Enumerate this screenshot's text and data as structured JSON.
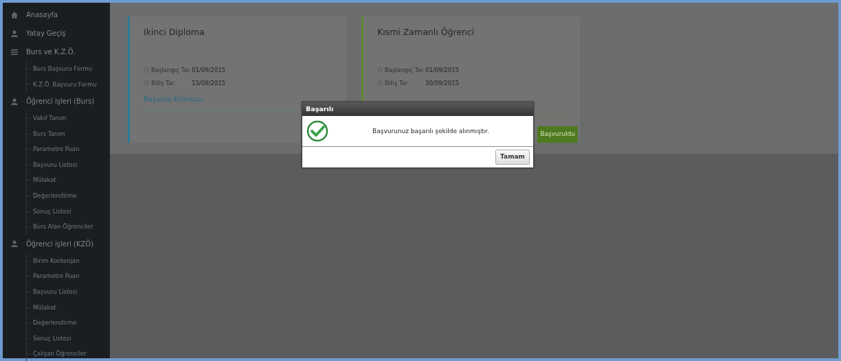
{
  "sidebar": {
    "items": [
      {
        "label": "Anasayfa"
      },
      {
        "label": "Yatay Geçiş"
      },
      {
        "label": "Burs ve K.Z.Ö.",
        "children": [
          {
            "label": "Burs Başvuru Formu"
          },
          {
            "label": "K.Z.Ö. Başvuru Formu"
          }
        ]
      },
      {
        "label": "Öğrenci işleri (Burs)",
        "children": [
          {
            "label": "Vakıf Tanım"
          },
          {
            "label": "Burs Tanım"
          },
          {
            "label": "Parametre Puan"
          },
          {
            "label": "Başvuru Listesi"
          },
          {
            "label": "Mülakat"
          },
          {
            "label": "Değerlendirme"
          },
          {
            "label": "Sonuç Listesi"
          },
          {
            "label": "Burs Alan Öğrenciler"
          }
        ]
      },
      {
        "label": "Öğrenci işleri (KZÖ)",
        "children": [
          {
            "label": "Birim Kontenjan"
          },
          {
            "label": "Parametre Puan"
          },
          {
            "label": "Başvuru Listesi"
          },
          {
            "label": "Mülakat"
          },
          {
            "label": "Değerlendirme"
          },
          {
            "label": "Sonuç Listesi"
          },
          {
            "label": "Çalışan Öğrenciler"
          }
        ]
      }
    ]
  },
  "cards": [
    {
      "title": "Ikinci Diploma",
      "color": "#2b7a95",
      "start_label": "Başlangıç Tar.",
      "start": "01/09/2015",
      "end_label": "Bitiş Tar.",
      "end": "15/09/2015",
      "link": "Başvuru Kılavuzu"
    },
    {
      "title": "Kısmi Zamanlı Öğrenci",
      "color": "#5e8a2e",
      "start_label": "Başlangıç Tar.",
      "start": "01/09/2015",
      "end_label": "Bitiş Tar.",
      "end": "30/09/2015",
      "button": "Başvuruldu"
    }
  ],
  "dialog": {
    "title": "Başarılı",
    "message": "Başvurunuz başarılı şekilde alınmıştır.",
    "button": "Tamam"
  }
}
